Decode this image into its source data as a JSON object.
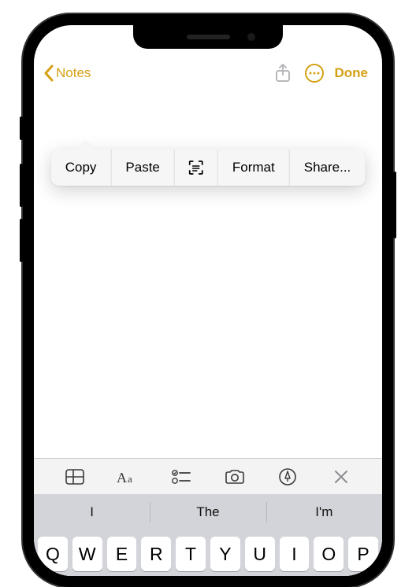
{
  "colors": {
    "accent": "#d4a014"
  },
  "nav": {
    "back_label": "Notes",
    "done_label": "Done"
  },
  "context_menu": {
    "items": [
      "Copy",
      "Paste",
      "__scan__",
      "Format",
      "Share..."
    ]
  },
  "toolbar": {
    "items": [
      "table",
      "text-format",
      "checklist",
      "camera",
      "markup",
      "close"
    ]
  },
  "suggestions": [
    "I",
    "The",
    "I'm"
  ],
  "keyboard_row": [
    "Q",
    "W",
    "E",
    "R",
    "T",
    "Y",
    "U",
    "I",
    "O",
    "P"
  ]
}
